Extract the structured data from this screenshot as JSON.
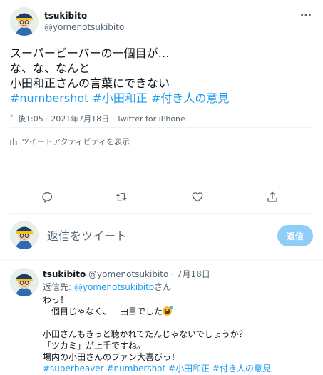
{
  "main_tweet": {
    "author": {
      "display_name": "tsukibito",
      "handle": "@yomenotsukibito"
    },
    "more_icon": "ellipsis-icon",
    "text_lines": [
      "スーパービーバーの一個目が…",
      "な、な、なんと",
      "小田和正さんの言葉にできない"
    ],
    "hashtags": "#numbershot #小田和正 #付き人の意見",
    "meta": "午後1:05 · 2021年7月18日 · Twitter for iPhone",
    "activity_label": "ツイートアクティビティを表示",
    "actions": [
      "reply-icon",
      "retweet-icon",
      "like-icon",
      "share-icon"
    ]
  },
  "reply_box": {
    "placeholder": "返信をツイート",
    "button_label": "返信"
  },
  "reply_tweet": {
    "display_name": "tsukibito",
    "handle": "@yomenotsukibito",
    "dot": "·",
    "date": "7月18日",
    "replying_to_prefix": "返信先: ",
    "replying_to_mention": "@yomenotsukibito",
    "replying_to_suffix": "さん",
    "lines": [
      "わっ！",
      "一個目じゃなく、一曲目でした",
      "",
      "小田さんもきっと聴かれてたんじゃないでしょうか？",
      "「ツカミ」が上手ですね。",
      "場内の小田さんのファン大喜びっ！"
    ],
    "tags": "#superbeaver #numbershot #小田和正 #付き人の意見"
  },
  "colors": {
    "accent": "#1d9bf0",
    "reply_button_disabled": "#8ecdf7",
    "secondary_text": "#536471",
    "divider": "#eff3f4"
  }
}
